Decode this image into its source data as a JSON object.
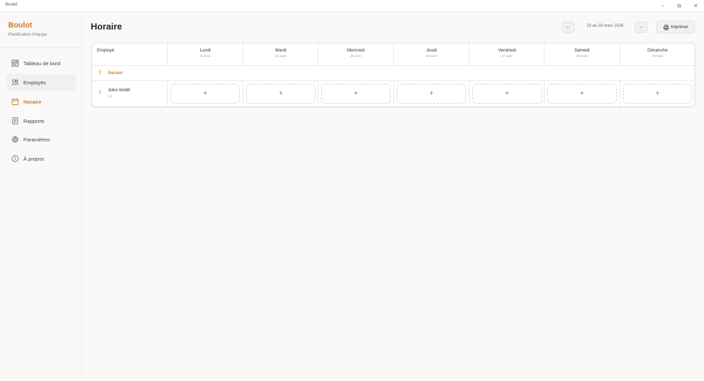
{
  "window": {
    "app_name": "Boulot",
    "controls": {
      "minimize": "–",
      "maximize": "⧉",
      "close": "✕"
    }
  },
  "sidebar": {
    "brand_title": "Boulot",
    "brand_subtitle": "Planification d'équipe",
    "items": [
      {
        "label": "Tableau de bord",
        "icon": "dashboard-icon",
        "state": "normal"
      },
      {
        "label": "Employés",
        "icon": "users-icon",
        "state": "hover"
      },
      {
        "label": "Horaire",
        "icon": "calendar-icon",
        "state": "active"
      },
      {
        "label": "Rapports",
        "icon": "report-icon",
        "state": "normal"
      },
      {
        "label": "Paramètres",
        "icon": "gear-icon",
        "state": "normal"
      },
      {
        "label": "À propos",
        "icon": "info-icon",
        "state": "normal"
      }
    ]
  },
  "header": {
    "title": "Horaire",
    "prev_label": "←",
    "next_label": "→",
    "week_range": "23 au 29 mars 2026",
    "print_label": "Imprimer"
  },
  "schedule": {
    "employee_header": "Employé",
    "days": [
      {
        "name": "Lundi",
        "date": "23 mars"
      },
      {
        "name": "Mardi",
        "date": "24 mars"
      },
      {
        "name": "Mercredi",
        "date": "25 mars"
      },
      {
        "name": "Jeudi",
        "date": "26 mars"
      },
      {
        "name": "Vendredi",
        "date": "27 mars"
      },
      {
        "name": "Samedi",
        "date": "28 mars"
      },
      {
        "name": "Dimanche",
        "date": "29 mars"
      }
    ],
    "group": {
      "label": "Gérant",
      "handle": "⠿"
    },
    "employees": [
      {
        "name": "John Smith",
        "hours": "0 h",
        "handle": "⠿"
      }
    ],
    "add_symbol": "+"
  },
  "colors": {
    "accent": "#c87d2a",
    "background": "#faf9f7",
    "card": "#ffffff",
    "border": "#e3e1dd"
  }
}
